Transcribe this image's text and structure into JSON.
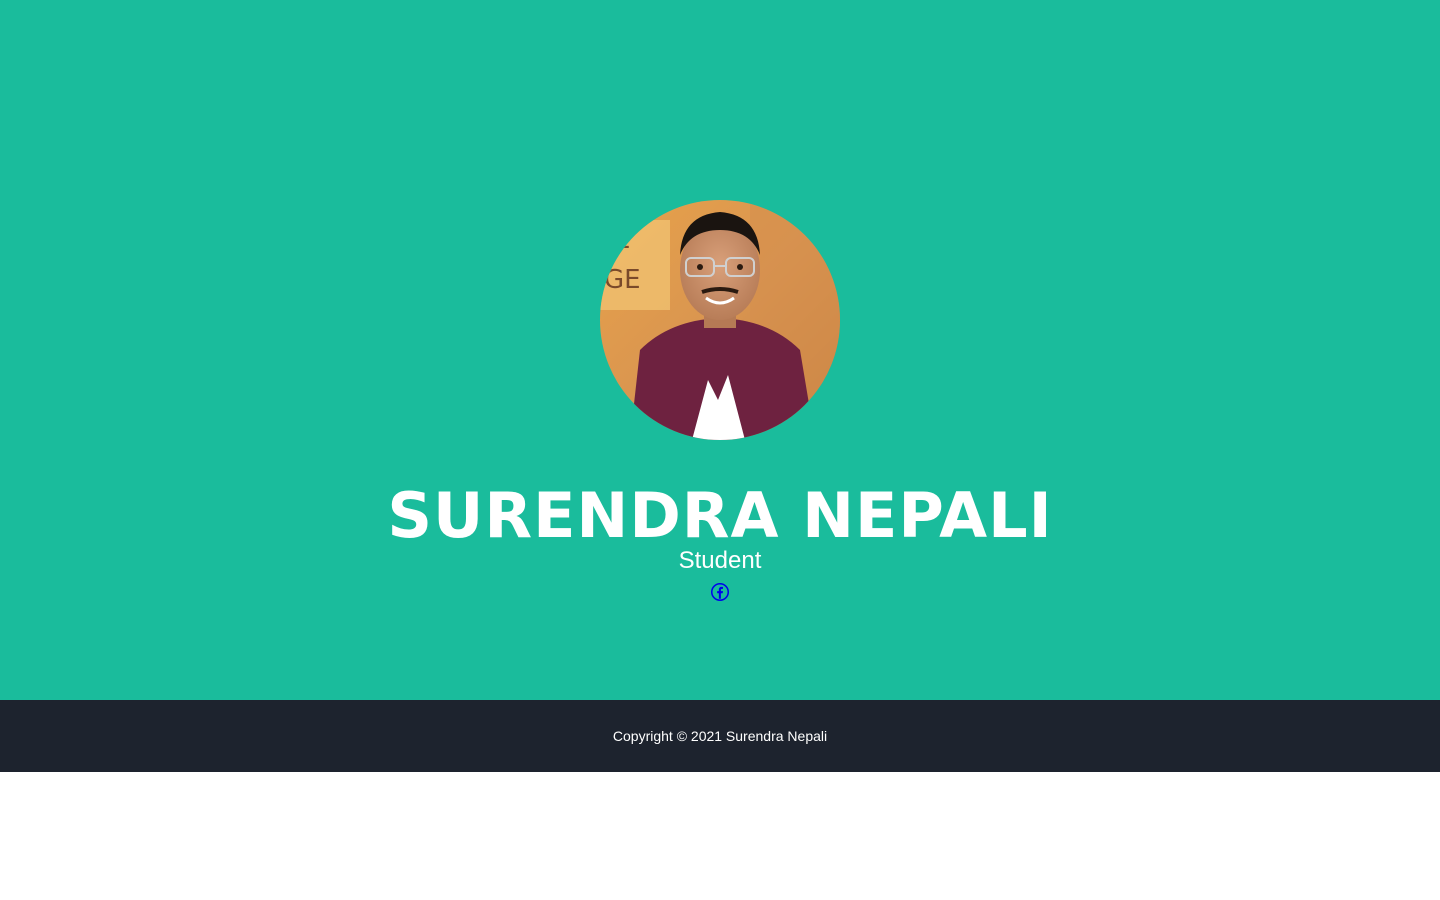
{
  "profile": {
    "name": "SURENDRA NEPALI",
    "role": "Student",
    "avatar_alt": "Surendra Nepali"
  },
  "social": {
    "facebook_icon": "facebook-icon",
    "facebook_color": "#0000ee"
  },
  "footer": {
    "copyright": "Copyright © 2021 Surendra Nepali"
  },
  "colors": {
    "hero_background": "#1abc9c",
    "footer_background": "#1d232e",
    "text": "#ffffff"
  }
}
